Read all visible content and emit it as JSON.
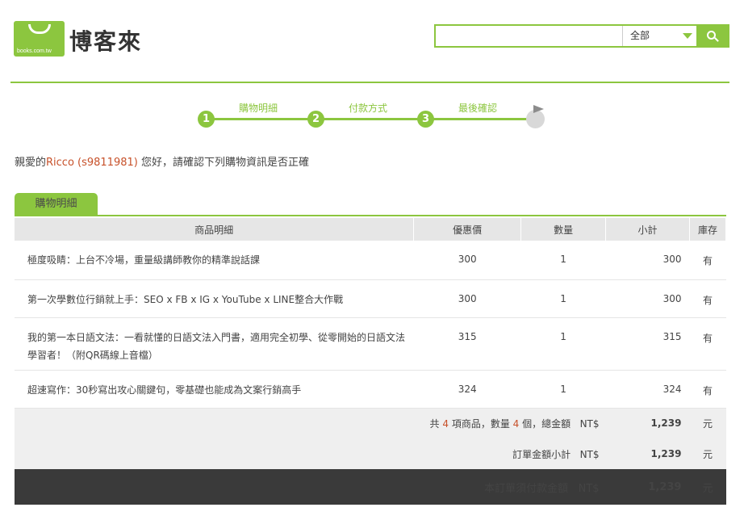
{
  "header": {
    "logo_text": "博客來",
    "logo_domain": "books.com.tw",
    "search_placeholder": "",
    "search_scope": "全部"
  },
  "steps": [
    {
      "num": "1",
      "label": "購物明細"
    },
    {
      "num": "2",
      "label": "付款方式"
    },
    {
      "num": "3",
      "label": "最後確認"
    }
  ],
  "greeting": {
    "prefix": "親愛的",
    "user": "Ricco (s9811981)",
    "suffix": " 您好，請確認下列購物資訊是否正確"
  },
  "tab_label": "購物明細",
  "table": {
    "headers": [
      "商品明細",
      "優惠價",
      "數量",
      "小計",
      "庫存"
    ],
    "rows": [
      {
        "name": "極度吸睛：上台不冷場，重量級講師教你的精準說話課",
        "price": "300",
        "qty": "1",
        "subtotal": "300",
        "stock": "有"
      },
      {
        "name": "第一次學數位行銷就上手：SEO x FB x IG x YouTube x LINE整合大作戰",
        "price": "300",
        "qty": "1",
        "subtotal": "300",
        "stock": "有"
      },
      {
        "name": "我的第一本日語文法：一看就懂的日語文法入門書，適用完全初學、從零開始的日語文法學習者！（附QR碼線上音檔）",
        "price": "315",
        "qty": "1",
        "subtotal": "315",
        "stock": "有"
      },
      {
        "name": "超速寫作：30秒寫出攻心關鍵句，零基礎也能成為文案行銷高手",
        "price": "324",
        "qty": "1",
        "subtotal": "324",
        "stock": "有"
      }
    ]
  },
  "summary": {
    "total_prefix": "共 ",
    "item_count": "4",
    "total_mid": " 項商品，數量 ",
    "qty_count": "4",
    "total_suffix": " 個，總金額",
    "currency": "NT$",
    "total_amount": "1,239",
    "unit": "元",
    "subtotal_label": "訂單金額小計",
    "subtotal_amount": "1,239",
    "final_label": "本訂單須付款金額",
    "final_amount": "1,239"
  },
  "colors": {
    "accent": "#8cc63f",
    "highlight": "#c7512a",
    "dark_bar": "#3a3a3a"
  }
}
